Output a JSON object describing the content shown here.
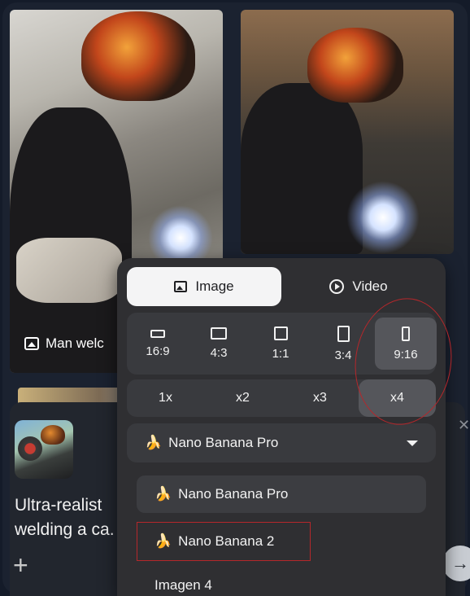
{
  "photos": {
    "left_caption": "Man welc"
  },
  "mode_toggle": {
    "image_label": "Image",
    "video_label": "Video",
    "selected": "Image"
  },
  "aspect_ratios": {
    "options": [
      "16:9",
      "4:3",
      "1:1",
      "3:4",
      "9:16"
    ],
    "selected": "9:16"
  },
  "counts": {
    "options": [
      "1x",
      "x2",
      "x3",
      "x4"
    ],
    "selected": "x4"
  },
  "model_select": {
    "icon": "banana",
    "value": "Nano Banana Pro"
  },
  "model_menu": {
    "items": [
      {
        "icon": "banana",
        "label": "Nano Banana Pro"
      },
      {
        "icon": "banana",
        "label": "Nano Banana 2"
      },
      {
        "icon": "",
        "label": "Imagen 4"
      }
    ]
  },
  "prompt": {
    "text": "Ultra-realist\nwelding a ca."
  },
  "colors": {
    "panel_bg": "#2f2f32",
    "selected_bg": "#55565b",
    "annotation_red": "#b5272b"
  },
  "icons": {
    "image": "image-icon",
    "video": "play-circle-icon",
    "add": "plus-icon",
    "close": "close-icon",
    "send": "arrow-right-icon",
    "dropdown": "chevron-down-icon"
  }
}
